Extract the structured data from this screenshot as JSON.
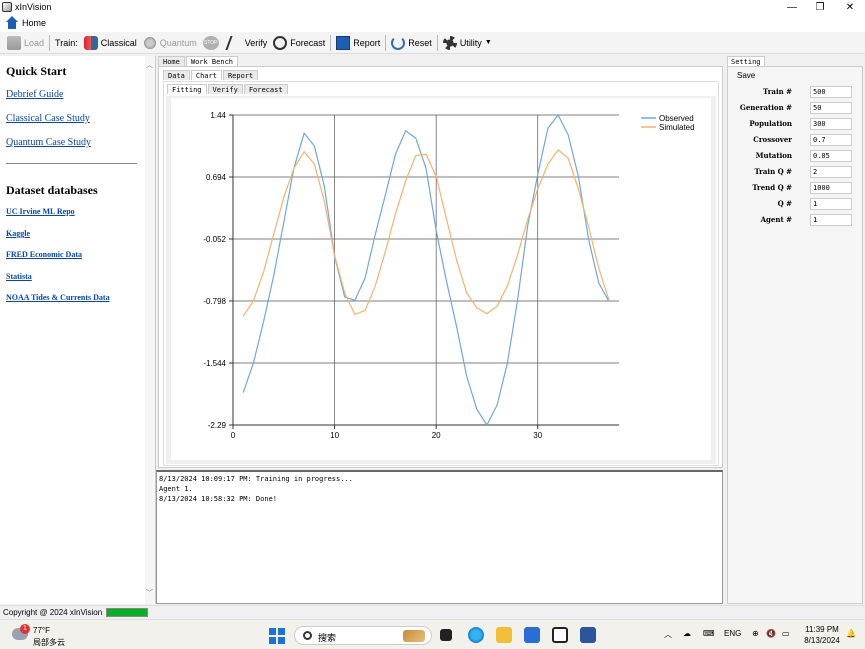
{
  "window": {
    "title": "xInVision"
  },
  "menu": {
    "home": "Home"
  },
  "toolbar": {
    "load": "Load",
    "train_label": "Train:",
    "classical": "Classical",
    "quantum": "Quantum",
    "stop": "STOP",
    "verify": "Verify",
    "forecast": "Forecast",
    "report": "Report",
    "reset": "Reset",
    "utility": "Utility"
  },
  "sidebar": {
    "quick_start_title": "Quick Start",
    "quick_links": [
      "Debrief Guide",
      "Classical Case Study",
      "Quantum Case Study"
    ],
    "dataset_title": "Dataset databases",
    "dataset_links": [
      "UC Irvine ML Repo",
      "Kaggle",
      "FRED Economic Data",
      "Statista",
      "NOAA Tides & Currents Data"
    ]
  },
  "workbench": {
    "tabs": [
      "Home",
      "Work Bench"
    ],
    "sub_tabs": [
      "Data",
      "Chart",
      "Report"
    ],
    "chart_tabs": [
      "Fitting",
      "Verify",
      "Forecast"
    ]
  },
  "chart_data": {
    "type": "line",
    "title": "",
    "xlabel": "",
    "ylabel": "",
    "xlim": [
      0,
      38
    ],
    "ylim": [
      -2.29,
      1.44
    ],
    "x_ticks": [
      0,
      10,
      20,
      30
    ],
    "y_ticks": [
      "1.44",
      "0.694",
      "-0.052",
      "-0.798",
      "-1.544",
      "-2.29"
    ],
    "grid": true,
    "legend_position": "top-right",
    "series": [
      {
        "name": "Observed",
        "color": "#6fa8dc",
        "x": [
          1,
          2,
          3,
          4,
          5,
          6,
          7,
          8,
          9,
          10,
          11,
          12,
          13,
          14,
          15,
          16,
          17,
          18,
          19,
          20,
          21,
          22,
          23,
          24,
          25,
          26,
          27,
          28,
          29,
          30,
          31,
          32,
          33,
          34,
          35,
          36,
          37
        ],
        "y": [
          -1.9,
          -1.55,
          -1.05,
          -0.5,
          0.15,
          0.8,
          1.22,
          1.07,
          0.58,
          -0.26,
          -0.75,
          -0.79,
          -0.52,
          0.0,
          0.48,
          0.97,
          1.25,
          1.16,
          0.8,
          0.05,
          -0.55,
          -1.1,
          -1.7,
          -2.1,
          -2.29,
          -2.05,
          -1.55,
          -0.8,
          0.1,
          0.72,
          1.28,
          1.44,
          1.2,
          0.7,
          -0.05,
          -0.58,
          -0.8
        ]
      },
      {
        "name": "Simulated",
        "color": "#f6b26b",
        "x": [
          1,
          2,
          3,
          4,
          5,
          6,
          7,
          8,
          9,
          10,
          11,
          12,
          13,
          14,
          15,
          16,
          17,
          18,
          19,
          20,
          21,
          22,
          23,
          24,
          25,
          26,
          27,
          28,
          29,
          30,
          31,
          32,
          33,
          34,
          35,
          36,
          37
        ],
        "y": [
          -0.98,
          -0.8,
          -0.45,
          0.0,
          0.45,
          0.8,
          1.0,
          0.85,
          0.4,
          -0.25,
          -0.7,
          -0.96,
          -0.91,
          -0.62,
          -0.2,
          0.25,
          0.65,
          0.95,
          0.97,
          0.7,
          0.2,
          -0.3,
          -0.7,
          -0.88,
          -0.95,
          -0.86,
          -0.62,
          -0.25,
          0.18,
          0.55,
          0.85,
          1.02,
          0.92,
          0.55,
          0.1,
          -0.4,
          -0.78
        ]
      }
    ]
  },
  "log": [
    "8/13/2024 10:09:17 PM: Training in progress...",
    "Agent 1.",
    "8/13/2024 10:58:32 PM: Done!"
  ],
  "settings": {
    "tab": "Setting",
    "save": "Save",
    "rows": [
      {
        "label": "Train #",
        "value": "500"
      },
      {
        "label": "Generation #",
        "value": "50"
      },
      {
        "label": "Population",
        "value": "300"
      },
      {
        "label": "Crossover",
        "value": "0.7"
      },
      {
        "label": "Mutation",
        "value": "0.05"
      },
      {
        "label": "Train Q #",
        "value": "2"
      },
      {
        "label": "Trend Q #",
        "value": "1000"
      },
      {
        "label": "Q #",
        "value": "1"
      },
      {
        "label": "Agent #",
        "value": "1"
      }
    ]
  },
  "status": {
    "copyright": "Copyright @ 2024 xInVision",
    "progress": 1.0
  },
  "taskbar": {
    "weather_badge": "1",
    "temp": "77°F",
    "weather_desc": "局部多云",
    "search": "搜索",
    "lang": "ENG",
    "time": "11:39 PM",
    "date": "8/13/2024"
  }
}
